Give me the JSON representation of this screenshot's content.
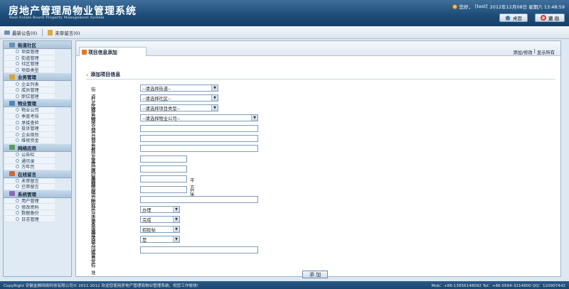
{
  "header": {
    "title": "房地产管理局物业管理系统",
    "subtitle": "Real Estate Board Property Management System",
    "greeting": "您好，",
    "user": "[test]",
    "datetime": "2012年12月08日 星期六 13:48:59",
    "home_label": "桌面",
    "logout_label": "退 出"
  },
  "notice_bar": {
    "latest_notice": "最新公告(0)",
    "unread_messages": "未审留言(0)"
  },
  "sidebar": {
    "sections": [
      {
        "title": "街道社区",
        "items": [
          "项目管理",
          "街道管理",
          "社区管理",
          "项目类型"
        ]
      },
      {
        "title": "业务管理",
        "items": [
          "企业列表",
          "成员管理",
          "职位管理"
        ]
      },
      {
        "title": "物业管理",
        "items": [
          "物业公司",
          "季度考核",
          "承接查验",
          "投诉管理",
          "企业级别",
          "维修资金"
        ]
      },
      {
        "title": "网络应用",
        "items": [
          "公告栏",
          "通讯录",
          "万年历"
        ]
      },
      {
        "title": "在线留言",
        "items": [
          "未审留言",
          "已审留言"
        ]
      },
      {
        "title": "系统管理",
        "items": [
          "用户管理",
          "修改密码",
          "数据备份",
          "日志管理"
        ]
      }
    ]
  },
  "main": {
    "tab_title": "项目信息添加",
    "action_add_edit": "添加/修改",
    "action_show_all": "显示所有",
    "section_title": "添加项目信息",
    "form": {
      "street_label": "街道名称",
      "street_value": "--请选择街道--",
      "community_label": "社区名称",
      "community_value": "--请选择社区--",
      "type_label": "项目类型",
      "type_value": "--请选择项目类型--",
      "company_label": "物业公司",
      "company_value": "--请选择物业公司--",
      "name_label": "项目名称",
      "location_label": "项目位置",
      "developer_label": "开发建筑单位",
      "delivery_label": "交付时间",
      "service_label": "服务期限",
      "area_label": "建筑面积",
      "area_unit": "平方米",
      "households_label": "住户数",
      "households_unit": "户",
      "honors_label": "所获荣誉",
      "acceptance_label": "验收备案",
      "acceptance_value": "办理",
      "inspection_label": "承接查验",
      "inspection_value": "完成",
      "hiring_label": "选聘方式",
      "hiring_value": "招投标",
      "contract_label": "合同备案",
      "contract_value": "是",
      "fee_label": "收费标准"
    },
    "submit_label": "添 加"
  },
  "footer": {
    "copyright": "CopyRight 安徽金狮网络科技有限公司© 2011-2012 欢迎您使用房地产管理局物业管理系统，祝您工作愉快!",
    "contact": "Mob：+86-13956148092 Tel：+86-0564-3214800 QQ：120907442"
  },
  "colors": {
    "header_bg": "#1d4b77",
    "accent": "#e07a20",
    "sidebar_bg": "#dfeaf5"
  }
}
